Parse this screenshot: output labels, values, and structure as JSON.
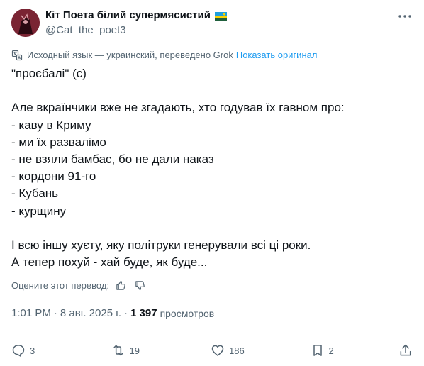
{
  "author": {
    "display_name": "Кіт Поета білий супермясистий",
    "handle": "@Cat_the_poet3",
    "flag_icon": "rwanda-flag-icon",
    "avatar_colors": {
      "background": "#6b1e2c",
      "figure": "#2b0a12",
      "accent": "#d9a0a8"
    }
  },
  "translation": {
    "note": "Исходный язык — украинский, переведено Grok",
    "show_original": "Показать оригинал"
  },
  "tweet": {
    "lines": [
      "\"проєбалі\" (с)",
      "",
      "Але вкраїнчики вже не згадають, хто годував їх гавном про:",
      "- каву в Криму",
      "- ми їх развалімо",
      "- не взяли бамбас, бо не дали наказ",
      "- кордони 91-го",
      "- Кубань",
      "- курщину",
      "",
      "І всю іншу хуєту, яку політруки генерували всі ці роки.",
      "А тепер похуй - хай буде, як буде..."
    ]
  },
  "rate_translation": {
    "label": "Оцените этот перевод:"
  },
  "meta": {
    "time": "1:01 PM",
    "date": "8 авг. 2025 г.",
    "separator": "·",
    "views_count": "1 397",
    "views_label": "просмотров"
  },
  "actions": {
    "replies": "3",
    "reposts": "19",
    "likes": "186",
    "bookmarks": "2"
  },
  "colors": {
    "text": "#0f1419",
    "secondary": "#536471",
    "link": "#1d9bf0",
    "divider": "#eff3f4"
  }
}
